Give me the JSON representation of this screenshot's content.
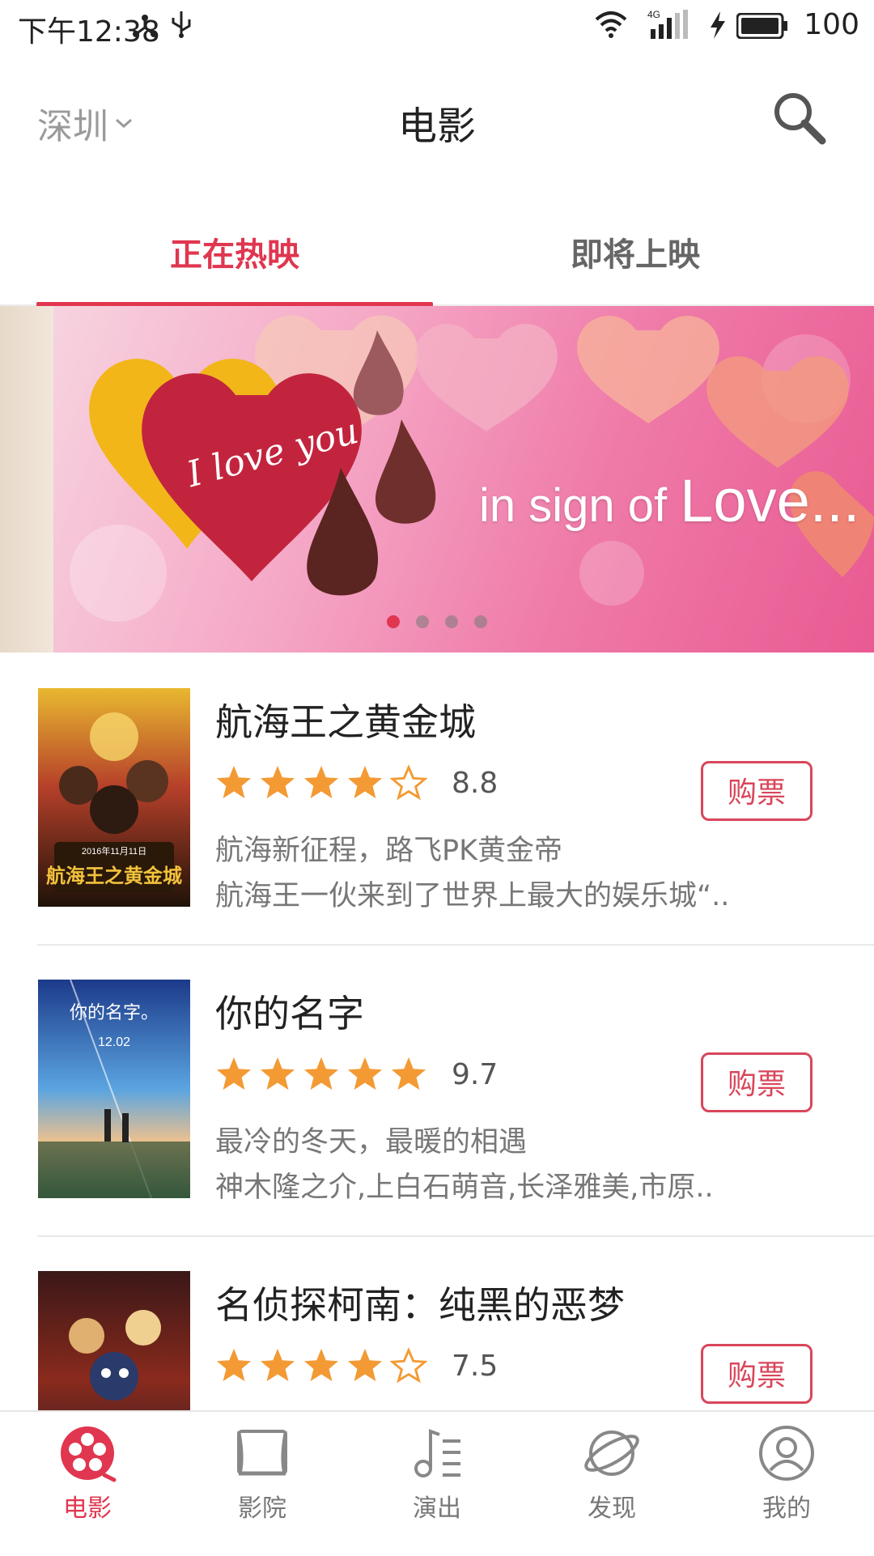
{
  "statusbar": {
    "time": "下午12:38",
    "signal_type": "4G",
    "battery": "100"
  },
  "header": {
    "city": "深圳",
    "title": "电影",
    "search_icon": "search-icon"
  },
  "tabs": [
    {
      "label": "正在热映",
      "active": true
    },
    {
      "label": "即将上映",
      "active": false
    }
  ],
  "banner": {
    "text_small": "in sign of",
    "text_big": "Love...",
    "heart_text": "I love you",
    "dots": 4,
    "active_dot": 0
  },
  "movies": [
    {
      "title": "航海王之黄金城",
      "rating": 4.5,
      "score": "8.8",
      "line1": "航海新征程，路飞PK黄金帝",
      "line2": "航海王一伙来到了世界上最大的娱乐城“..",
      "buy_label": "购票"
    },
    {
      "title": "你的名字",
      "rating": 5,
      "score": "9.7",
      "line1": "最冷的冬天，最暖的相遇",
      "line2": "神木隆之介,上白石萌音,长泽雅美,市原..",
      "buy_label": "购票"
    },
    {
      "title": "名侦探柯南：纯黑的恶梦",
      "rating": 4.5,
      "score": "7.5",
      "line1": "",
      "line2": "",
      "buy_label": "购票"
    }
  ],
  "posters": {
    "p1_date": "2016年11月11日",
    "p1_name": "航海王之黄金城",
    "p2_title": "你的名字。",
    "p2_date": "12.02"
  },
  "bottomnav": [
    {
      "label": "电影",
      "icon": "film-reel-icon",
      "active": true
    },
    {
      "label": "影院",
      "icon": "theater-icon",
      "active": false
    },
    {
      "label": "演出",
      "icon": "music-note-icon",
      "active": false
    },
    {
      "label": "发现",
      "icon": "planet-icon",
      "active": false
    },
    {
      "label": "我的",
      "icon": "user-icon",
      "active": false
    }
  ],
  "colors": {
    "accent": "#e0364f",
    "star": "#f39a34"
  }
}
